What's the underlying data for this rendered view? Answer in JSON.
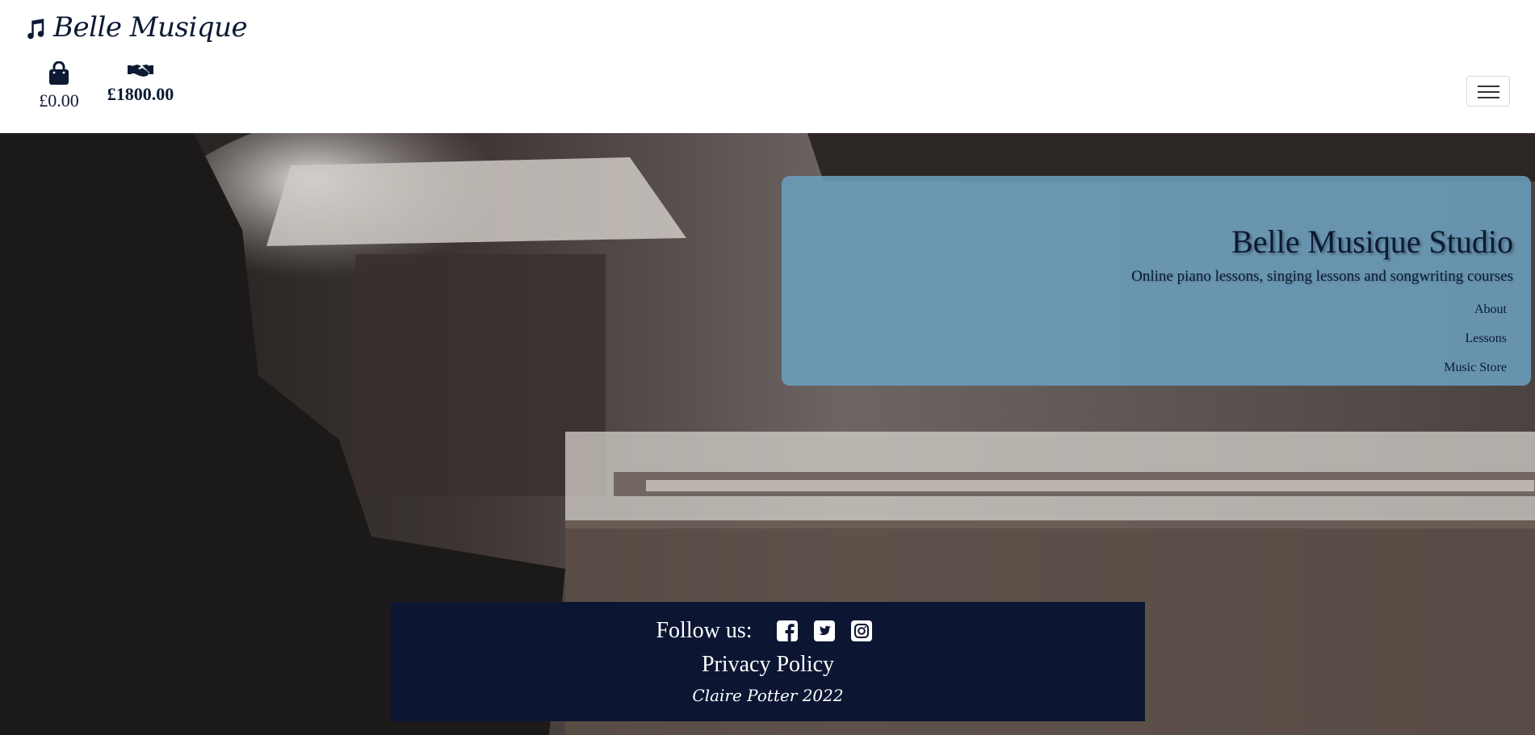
{
  "header": {
    "brand_name": "Belle Musique",
    "cart_total": "£0.00",
    "funds_total": "£1800.00"
  },
  "hero": {
    "title": "Belle Musique Studio",
    "subtitle": "Online piano lessons, singing lessons and songwriting courses",
    "links": [
      "About",
      "Lessons",
      "Music Store"
    ]
  },
  "footer": {
    "follow_label": "Follow us:",
    "privacy_label": "Privacy Policy",
    "credit": "Claire Potter 2022"
  },
  "colors": {
    "brand_navy": "#0c1a33",
    "footer_bg": "#0c1633",
    "hero_panel": "#6b9ebd"
  },
  "icons": [
    "music-note-icon",
    "shopping-bag-icon",
    "handshake-icon",
    "hamburger-icon",
    "facebook-icon",
    "twitter-icon",
    "instagram-icon"
  ]
}
